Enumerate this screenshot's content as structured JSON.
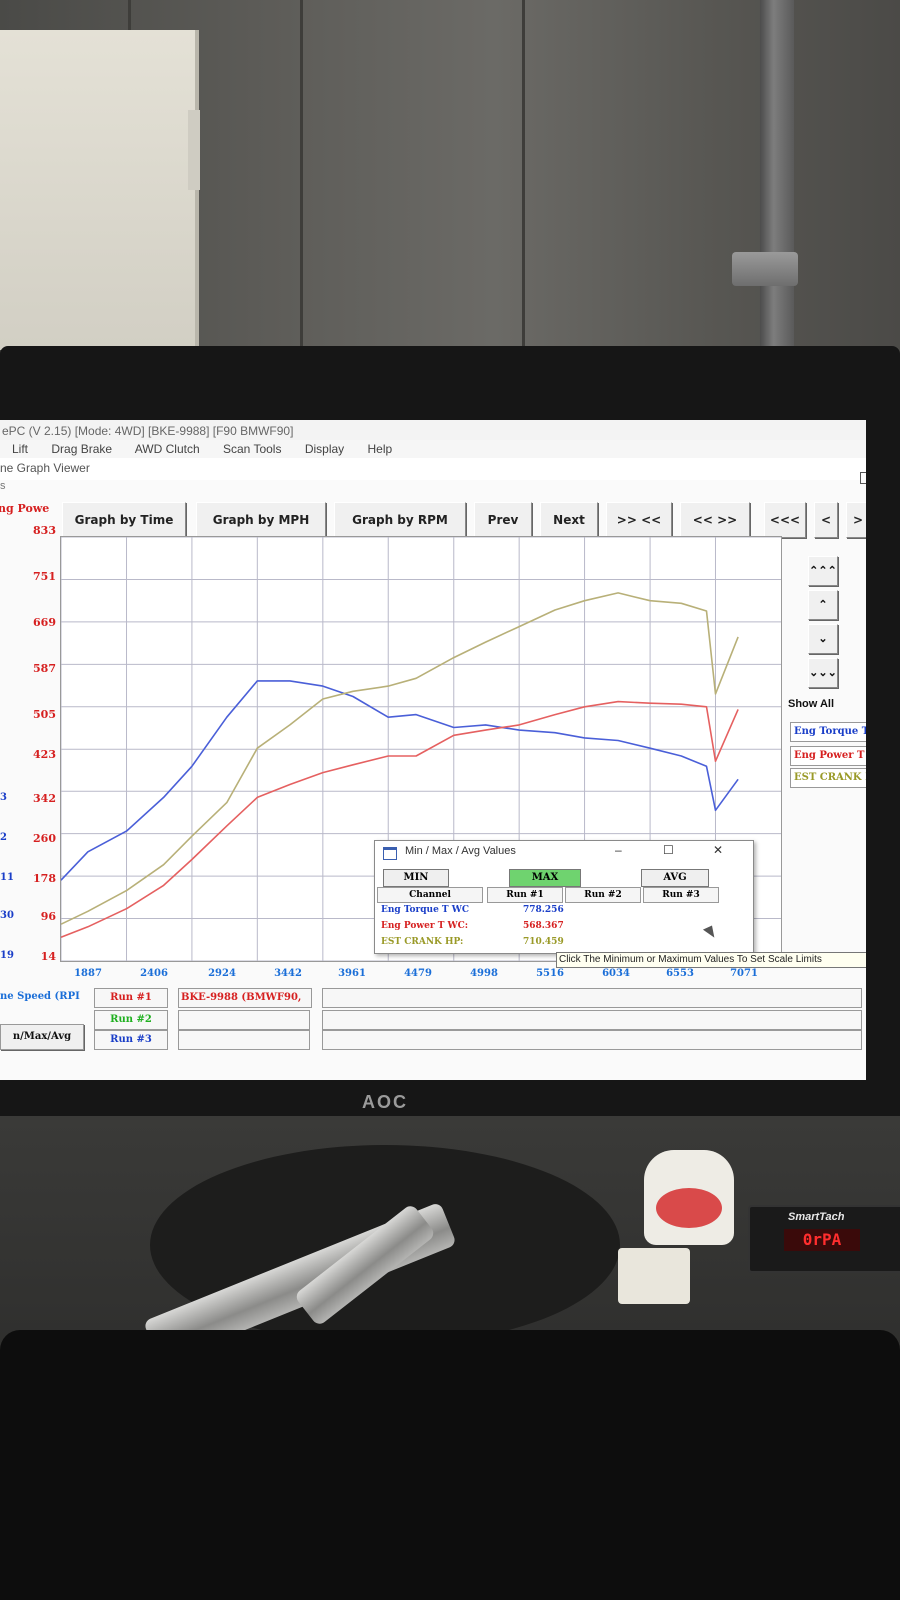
{
  "window": {
    "title": "ePC (V 2.15) [Mode: 4WD] [BKE-9988] [F90 BMWF90]",
    "menu": [
      "Lift",
      "Drag Brake",
      "AWD Clutch",
      "Scan Tools",
      "Display",
      "Help"
    ],
    "subtitle": "ne Graph Viewer",
    "s_label": "s"
  },
  "toolbar": {
    "graph_by_time": "Graph by Time",
    "graph_by_mph": "Graph by MPH",
    "graph_by_rpm": "Graph by RPM",
    "prev": "Prev",
    "next": "Next",
    "zoom_in": ">> <<",
    "zoom_out": "<< >>",
    "far_left": "<<<",
    "left": "<",
    "right": ">"
  },
  "nav": {
    "up_fast": "⌃⌃⌃",
    "up": "⌃",
    "down": "⌄",
    "down_fast": "⌄⌄⌄",
    "show_all": "Show All"
  },
  "channel_label": "ng Powe",
  "left_ticks": [
    "3",
    "2",
    "11",
    "30",
    "19"
  ],
  "bottom": {
    "speed_label": "ne Speed (RPI",
    "min_max_avg": "n/Max/Avg",
    "runs": [
      {
        "label": "Run #1",
        "name": "BKE-9988 (BMWF90,",
        "color": "#d62020"
      },
      {
        "label": "Run #2",
        "name": "",
        "color": "#20b020"
      },
      {
        "label": "Run #3",
        "name": "",
        "color": "#1a3ec8"
      }
    ]
  },
  "tooltip": "Click The Minimum or Maximum Values To Set Scale Limits",
  "legend": [
    {
      "name": "Eng Torque T WC",
      "color": "#1a3ec8"
    },
    {
      "name": "Eng Power T WC",
      "color": "#d62020"
    },
    {
      "name": "EST CRANK HP:",
      "color": "#9a9a28"
    }
  ],
  "dialog": {
    "title": "Min / Max / Avg Values",
    "min": "MIN",
    "max": "MAX",
    "avg": "AVG",
    "headers": [
      "Channel",
      "Run #1",
      "Run #2",
      "Run #3"
    ],
    "rows": [
      {
        "channel": "Eng Torque T WC",
        "run1": "778.256",
        "color": "#1a3ec8"
      },
      {
        "channel": "Eng Power T WC:",
        "run1": "568.367",
        "color": "#d62020"
      },
      {
        "channel": "EST CRANK HP:",
        "run1": "710.459",
        "color": "#9a9a28"
      }
    ]
  },
  "photo": {
    "monitor_brand": "AOC",
    "smarttach_title": "SmartTach",
    "smarttach_display": "0rPA"
  },
  "chart_data": {
    "type": "line",
    "x_ticks": [
      "1887",
      "2406",
      "2924",
      "3442",
      "3961",
      "4479",
      "4998",
      "5516",
      "6034",
      "6553",
      "7071"
    ],
    "y_ticks": [
      "833",
      "751",
      "669",
      "587",
      "505",
      "423",
      "342",
      "260",
      "178",
      "96",
      "14"
    ],
    "xlim": [
      1887,
      7590
    ],
    "ylim": [
      14,
      833
    ],
    "grid": true,
    "series": [
      {
        "name": "Eng Torque T WC",
        "color": "#4a5fd8",
        "points": [
          [
            1887,
            170
          ],
          [
            2100,
            225
          ],
          [
            2406,
            265
          ],
          [
            2700,
            330
          ],
          [
            2924,
            390
          ],
          [
            3200,
            485
          ],
          [
            3442,
            555
          ],
          [
            3700,
            555
          ],
          [
            3961,
            545
          ],
          [
            4200,
            525
          ],
          [
            4479,
            485
          ],
          [
            4700,
            490
          ],
          [
            4998,
            465
          ],
          [
            5250,
            470
          ],
          [
            5516,
            460
          ],
          [
            5800,
            455
          ],
          [
            6034,
            445
          ],
          [
            6300,
            440
          ],
          [
            6553,
            425
          ],
          [
            6800,
            410
          ],
          [
            7000,
            390
          ],
          [
            7071,
            305
          ],
          [
            7250,
            365
          ]
        ]
      },
      {
        "name": "Eng Power T WC",
        "color": "#e56060",
        "points": [
          [
            1887,
            60
          ],
          [
            2100,
            80
          ],
          [
            2406,
            115
          ],
          [
            2700,
            160
          ],
          [
            2924,
            210
          ],
          [
            3200,
            275
          ],
          [
            3442,
            330
          ],
          [
            3700,
            355
          ],
          [
            3961,
            378
          ],
          [
            4200,
            393
          ],
          [
            4479,
            410
          ],
          [
            4700,
            410
          ],
          [
            4998,
            450
          ],
          [
            5250,
            460
          ],
          [
            5516,
            470
          ],
          [
            5800,
            490
          ],
          [
            6034,
            505
          ],
          [
            6300,
            515
          ],
          [
            6553,
            512
          ],
          [
            6800,
            510
          ],
          [
            7000,
            505
          ],
          [
            7071,
            400
          ],
          [
            7250,
            500
          ]
        ]
      },
      {
        "name": "EST CRANK HP:",
        "color": "#b8b078",
        "points": [
          [
            1887,
            85
          ],
          [
            2100,
            110
          ],
          [
            2406,
            150
          ],
          [
            2700,
            200
          ],
          [
            2924,
            255
          ],
          [
            3200,
            320
          ],
          [
            3442,
            425
          ],
          [
            3700,
            470
          ],
          [
            3961,
            520
          ],
          [
            4200,
            535
          ],
          [
            4479,
            545
          ],
          [
            4700,
            560
          ],
          [
            4998,
            600
          ],
          [
            5250,
            630
          ],
          [
            5516,
            660
          ],
          [
            5800,
            692
          ],
          [
            6034,
            710
          ],
          [
            6300,
            725
          ],
          [
            6553,
            710
          ],
          [
            6800,
            705
          ],
          [
            7000,
            690
          ],
          [
            7071,
            530
          ],
          [
            7250,
            640
          ]
        ]
      }
    ]
  }
}
